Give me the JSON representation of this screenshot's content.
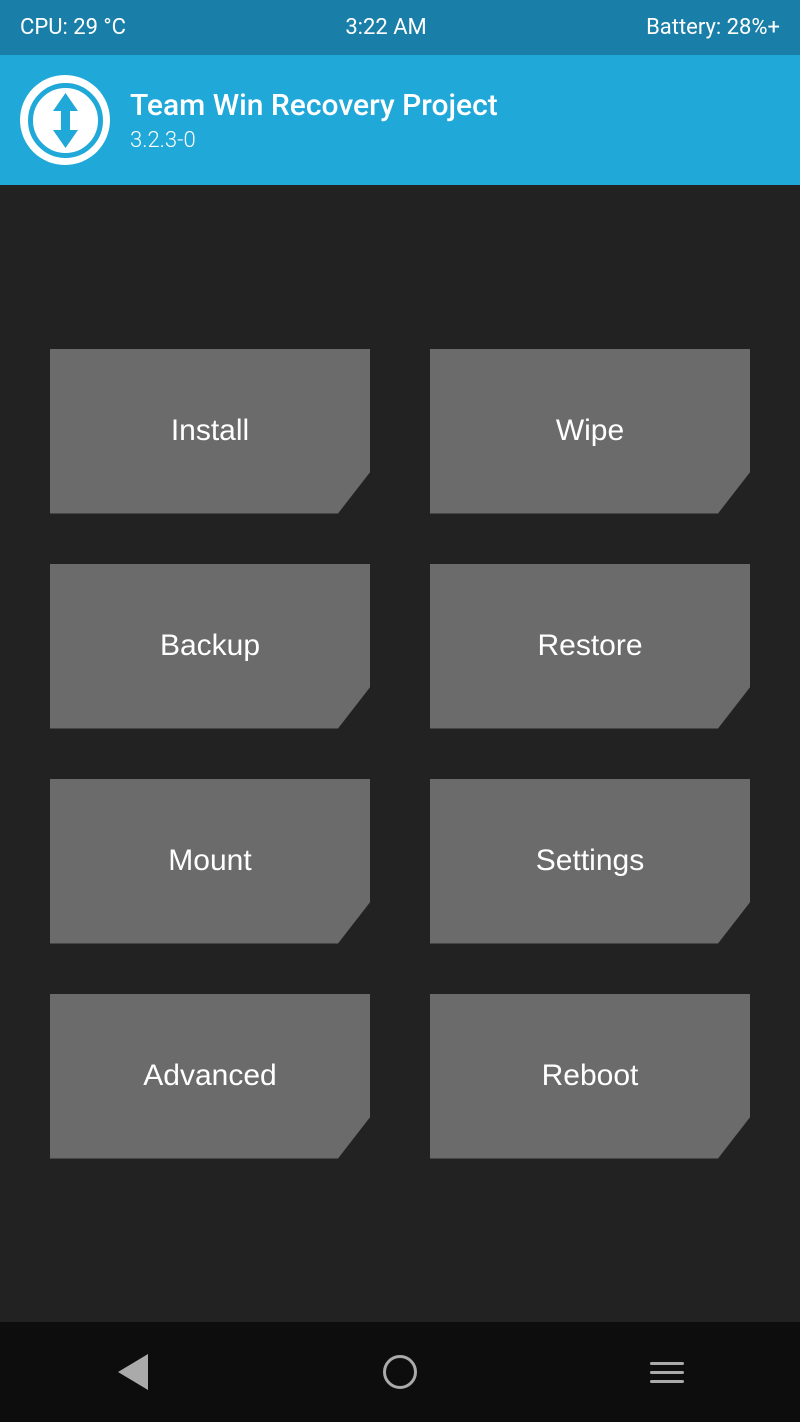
{
  "statusBar": {
    "cpu": "CPU: 29 °C",
    "time": "3:22 AM",
    "battery": "Battery: 28%+"
  },
  "header": {
    "title": "Team Win Recovery Project",
    "version": "3.2.3-0"
  },
  "buttons": [
    {
      "id": "install",
      "label": "Install"
    },
    {
      "id": "wipe",
      "label": "Wipe"
    },
    {
      "id": "backup",
      "label": "Backup"
    },
    {
      "id": "restore",
      "label": "Restore"
    },
    {
      "id": "mount",
      "label": "Mount"
    },
    {
      "id": "settings",
      "label": "Settings"
    },
    {
      "id": "advanced",
      "label": "Advanced"
    },
    {
      "id": "reboot",
      "label": "Reboot"
    }
  ],
  "colors": {
    "headerBg": "#1fa8d8",
    "statusBarBg": "#1a7fa8",
    "buttonBg": "#6b6b6b",
    "mainBg": "#222222",
    "navBg": "#0d0d0d"
  }
}
